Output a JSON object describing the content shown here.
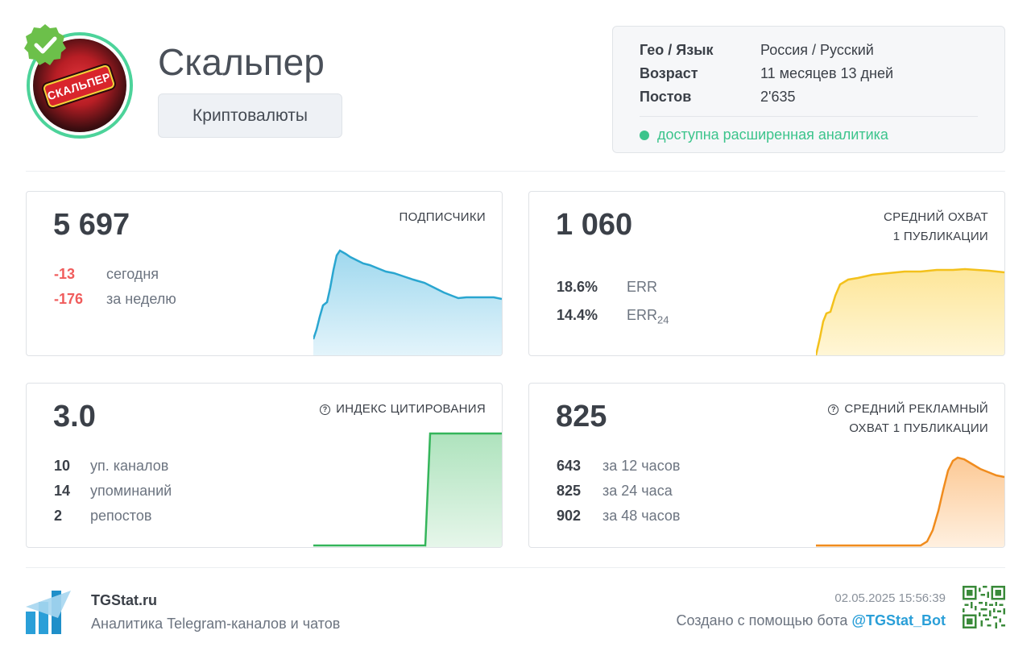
{
  "channel": {
    "title": "Скальпер",
    "category": "Криптовалюты",
    "avatar_text": "СКАЛЬПЕР"
  },
  "info": {
    "geo_label": "Гео / Язык",
    "geo_value": "Россия / Русский",
    "age_label": "Возраст",
    "age_value": "11 месяцев 13 дней",
    "posts_label": "Постов",
    "posts_value": "2'635",
    "analytics_note": "доступна расширенная аналитика"
  },
  "subscribers": {
    "value": "5 697",
    "label": "ПОДПИСЧИКИ",
    "today_value": "-13",
    "today_label": "сегодня",
    "week_value": "-176",
    "week_label": "за неделю"
  },
  "reach": {
    "value": "1 060",
    "label_line1": "СРЕДНИЙ ОХВАТ",
    "label_line2": "1 ПУБЛИКАЦИИ",
    "err_value": "18.6%",
    "err_label": "ERR",
    "err24_value": "14.4%",
    "err24_label": "ERR",
    "err24_sub": "24"
  },
  "citation": {
    "value": "3.0",
    "label": "ИНДЕКС ЦИТИРОВАНИЯ",
    "channels_value": "10",
    "channels_label": "уп. каналов",
    "mentions_value": "14",
    "mentions_label": "упоминаний",
    "reposts_value": "2",
    "reposts_label": "репостов"
  },
  "ad_reach": {
    "value": "825",
    "label_line1": "СРЕДНИЙ РЕКЛАМНЫЙ",
    "label_line2": "ОХВАТ 1 ПУБЛИКАЦИИ",
    "h12_value": "643",
    "h12_label": "за 12 часов",
    "h24_value": "825",
    "h24_label": "за 24 часа",
    "h48_value": "902",
    "h48_label": "за 48 часов"
  },
  "footer": {
    "brand": "TGStat.ru",
    "tagline": "Аналитика Telegram-каналов и чатов",
    "date": "02.05.2025 15:56:39",
    "created_prefix": "Создано с помощью бота",
    "bot": "@TGStat_Bot"
  },
  "colors": {
    "accent_green": "#3cc48c",
    "negative": "#f05c5c",
    "subscribers_line": "#2aa6d0",
    "reach_line": "#f3c11c",
    "citation_line": "#34b55a",
    "ad_line": "#f08c1e",
    "link": "#2a9fd8"
  },
  "icons": [
    "verified-badge-icon",
    "help-circle-icon",
    "tgstat-logo-icon",
    "qr-code-icon"
  ]
}
